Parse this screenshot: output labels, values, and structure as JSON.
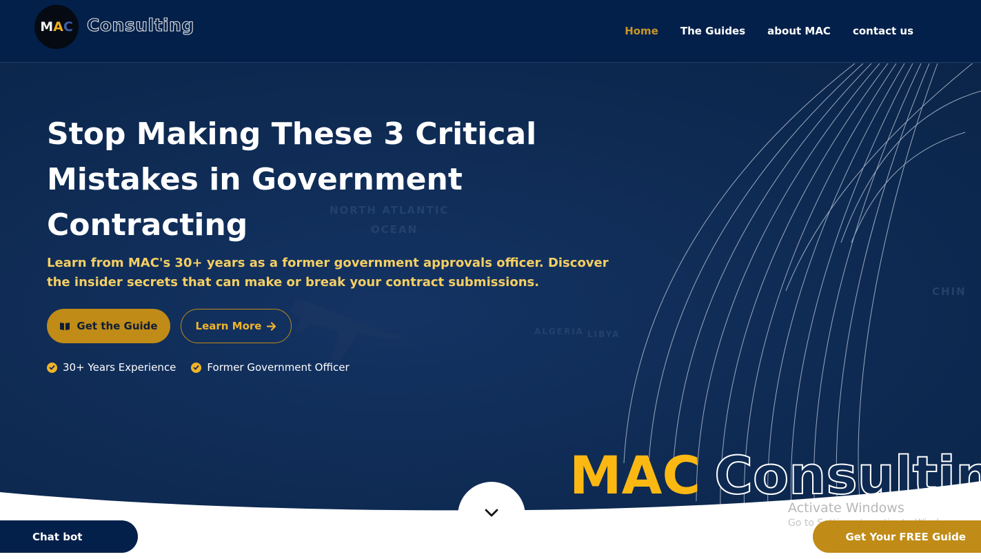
{
  "header": {
    "logo": {
      "m": "M",
      "a": "A",
      "c": "C"
    },
    "brand_word": "Consulting",
    "nav": [
      {
        "label": "Home",
        "active": true
      },
      {
        "label": "The Guides",
        "active": false
      },
      {
        "label": "about MAC",
        "active": false
      },
      {
        "label": "contact us",
        "active": false
      }
    ]
  },
  "hero": {
    "headline": "Stop Making These 3 Critical Mistakes in Government Contracting",
    "subhead": "Learn from MAC's 30+ years as a former government approvals officer. Discover the insider secrets that can make or break your contract submissions.",
    "cta_primary": "Get the Guide",
    "cta_secondary": "Learn More",
    "badges": [
      "30+ Years Experience",
      "Former Government Officer"
    ],
    "map_labels": [
      "NORTH ATLANTIC",
      "OCEAN",
      "ALGERIA",
      "LIBYA",
      "CHIN"
    ],
    "brand_mac": "MAC",
    "brand_consulting": "Consulting"
  },
  "system": {
    "activate_title": "Activate Windows",
    "activate_sub": "Go to Settings to activate Windows."
  },
  "widgets": {
    "chat_bot": "Chat bot",
    "free_guide": "Get Your FREE Guide"
  },
  "colors": {
    "navy": "#03204a",
    "hero": "#0e2a52",
    "gold": "#c08b17",
    "gold_text": "#f5cf63",
    "accent_yellow": "#fbb813"
  },
  "icons": {
    "cta_primary": "book-icon",
    "cta_secondary": "arrow-right-icon",
    "badge": "check-circle-icon",
    "scroll": "chevron-down-icon"
  }
}
